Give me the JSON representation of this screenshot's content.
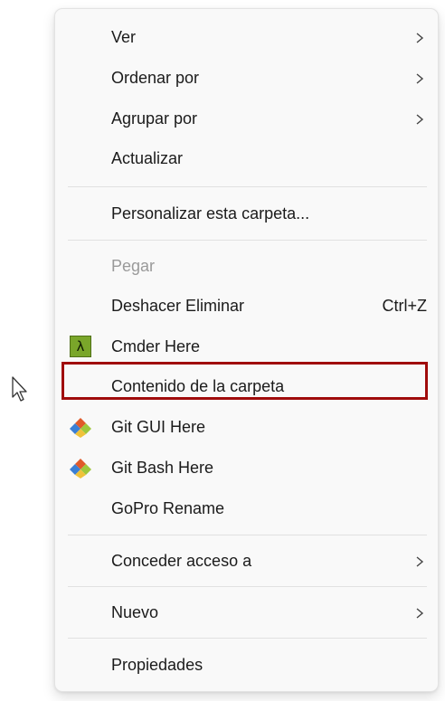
{
  "context_menu": {
    "items": [
      {
        "label": "Ver",
        "submenu": true
      },
      {
        "label": "Ordenar por",
        "submenu": true
      },
      {
        "label": "Agrupar por",
        "submenu": true
      },
      {
        "label": "Actualizar"
      },
      {
        "label": "Personalizar esta carpeta..."
      },
      {
        "label": "Pegar",
        "disabled": true
      },
      {
        "label": "Deshacer Eliminar",
        "shortcut": "Ctrl+Z"
      },
      {
        "label": "Cmder Here",
        "icon": "cmder-lambda-icon",
        "icon_glyph": "λ"
      },
      {
        "label": "Contenido de la carpeta",
        "highlighted": true
      },
      {
        "label": "Git GUI Here",
        "icon": "git-icon"
      },
      {
        "label": "Git Bash Here",
        "icon": "git-icon"
      },
      {
        "label": "GoPro Rename"
      },
      {
        "label": "Conceder acceso a",
        "submenu": true
      },
      {
        "label": "Nuevo",
        "submenu": true
      },
      {
        "label": "Propiedades"
      }
    ]
  },
  "colors": {
    "menu_background": "#f9f9f9",
    "highlight_border": "#a00c0c",
    "disabled_text": "#9a9a9a",
    "cmder_icon_green": "#7aa62a"
  }
}
